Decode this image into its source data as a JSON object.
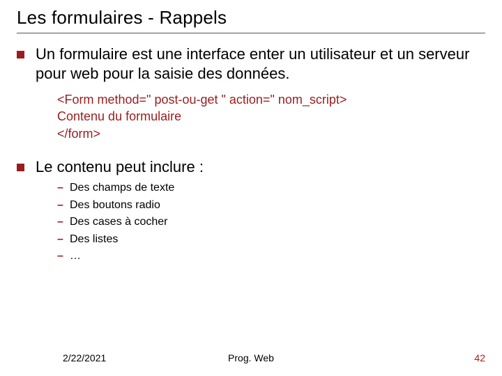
{
  "title": "Les formulaires - Rappels",
  "bullets": [
    {
      "text": "Un formulaire est une interface enter un utilisateur et un serveur pour web pour la saisie des données."
    },
    {
      "text": "Le contenu peut inclure :"
    }
  ],
  "code": {
    "line1": "<Form method=\" post-ou-get \" action=\" nom_script>",
    "line2": "Contenu du formulaire",
    "line3": "</form>"
  },
  "subitems": [
    "Des champs de texte",
    "Des boutons radio",
    "Des cases à cocher",
    "Des listes",
    "…"
  ],
  "footer": {
    "date": "2/22/2021",
    "center": "Prog. Web",
    "page": "42"
  }
}
